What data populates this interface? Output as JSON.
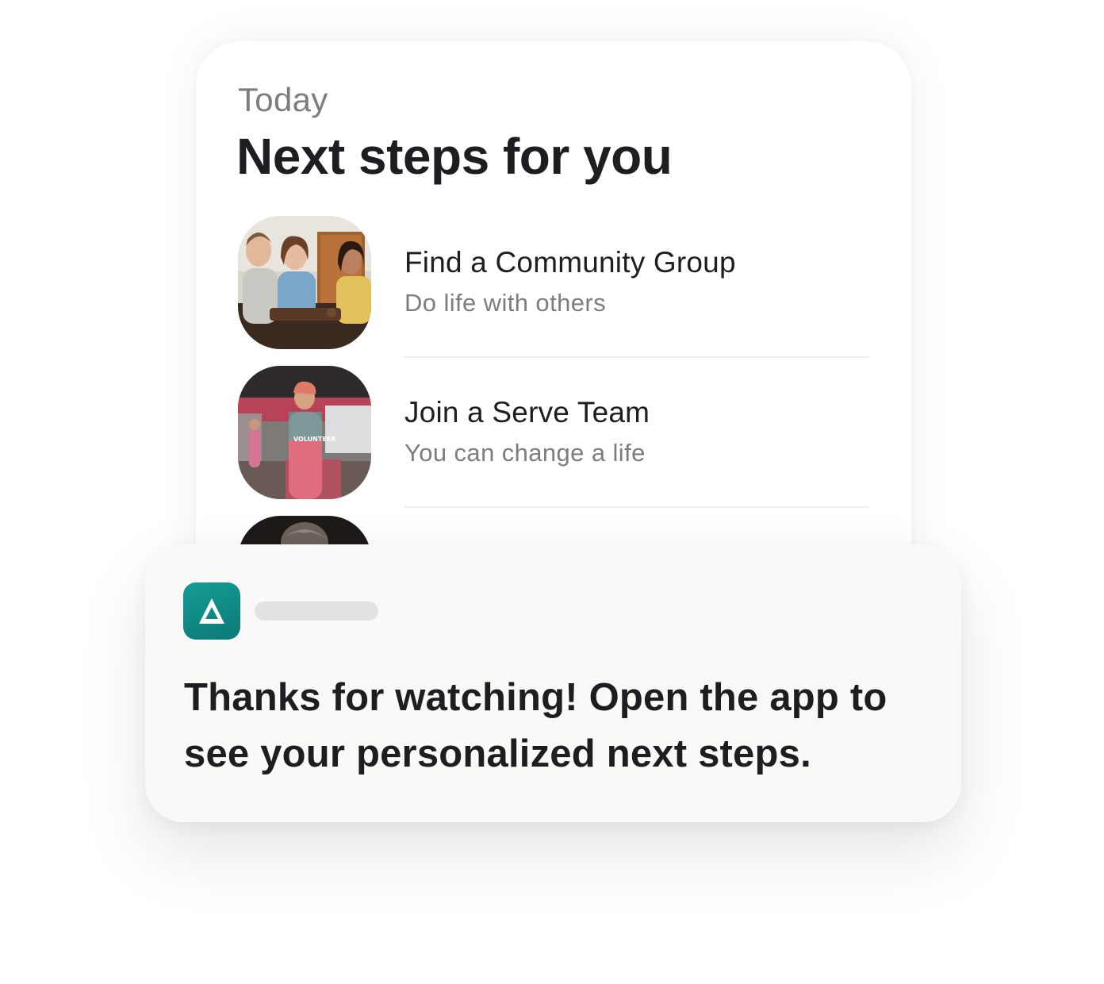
{
  "section_label": "Today",
  "title": "Next steps for you",
  "steps": [
    {
      "title": "Find a Community Group",
      "subtitle": "Do life with others",
      "image": "people-at-table-photo"
    },
    {
      "title": "Join a Serve Team",
      "subtitle": "You can change a life",
      "image": "volunteer-photo"
    },
    {
      "title": "",
      "subtitle": "",
      "image": "partial-photo"
    }
  ],
  "notification": {
    "app_icon": "delta-app-icon",
    "app_icon_color": "#0f8a85",
    "message": "Thanks for watching! Open the app to see your personalized next steps."
  },
  "colors": {
    "text_primary": "#1e1e22",
    "text_secondary": "#7d7d80",
    "divider": "#efeff1",
    "notification_bg": "#f9f9f8"
  }
}
